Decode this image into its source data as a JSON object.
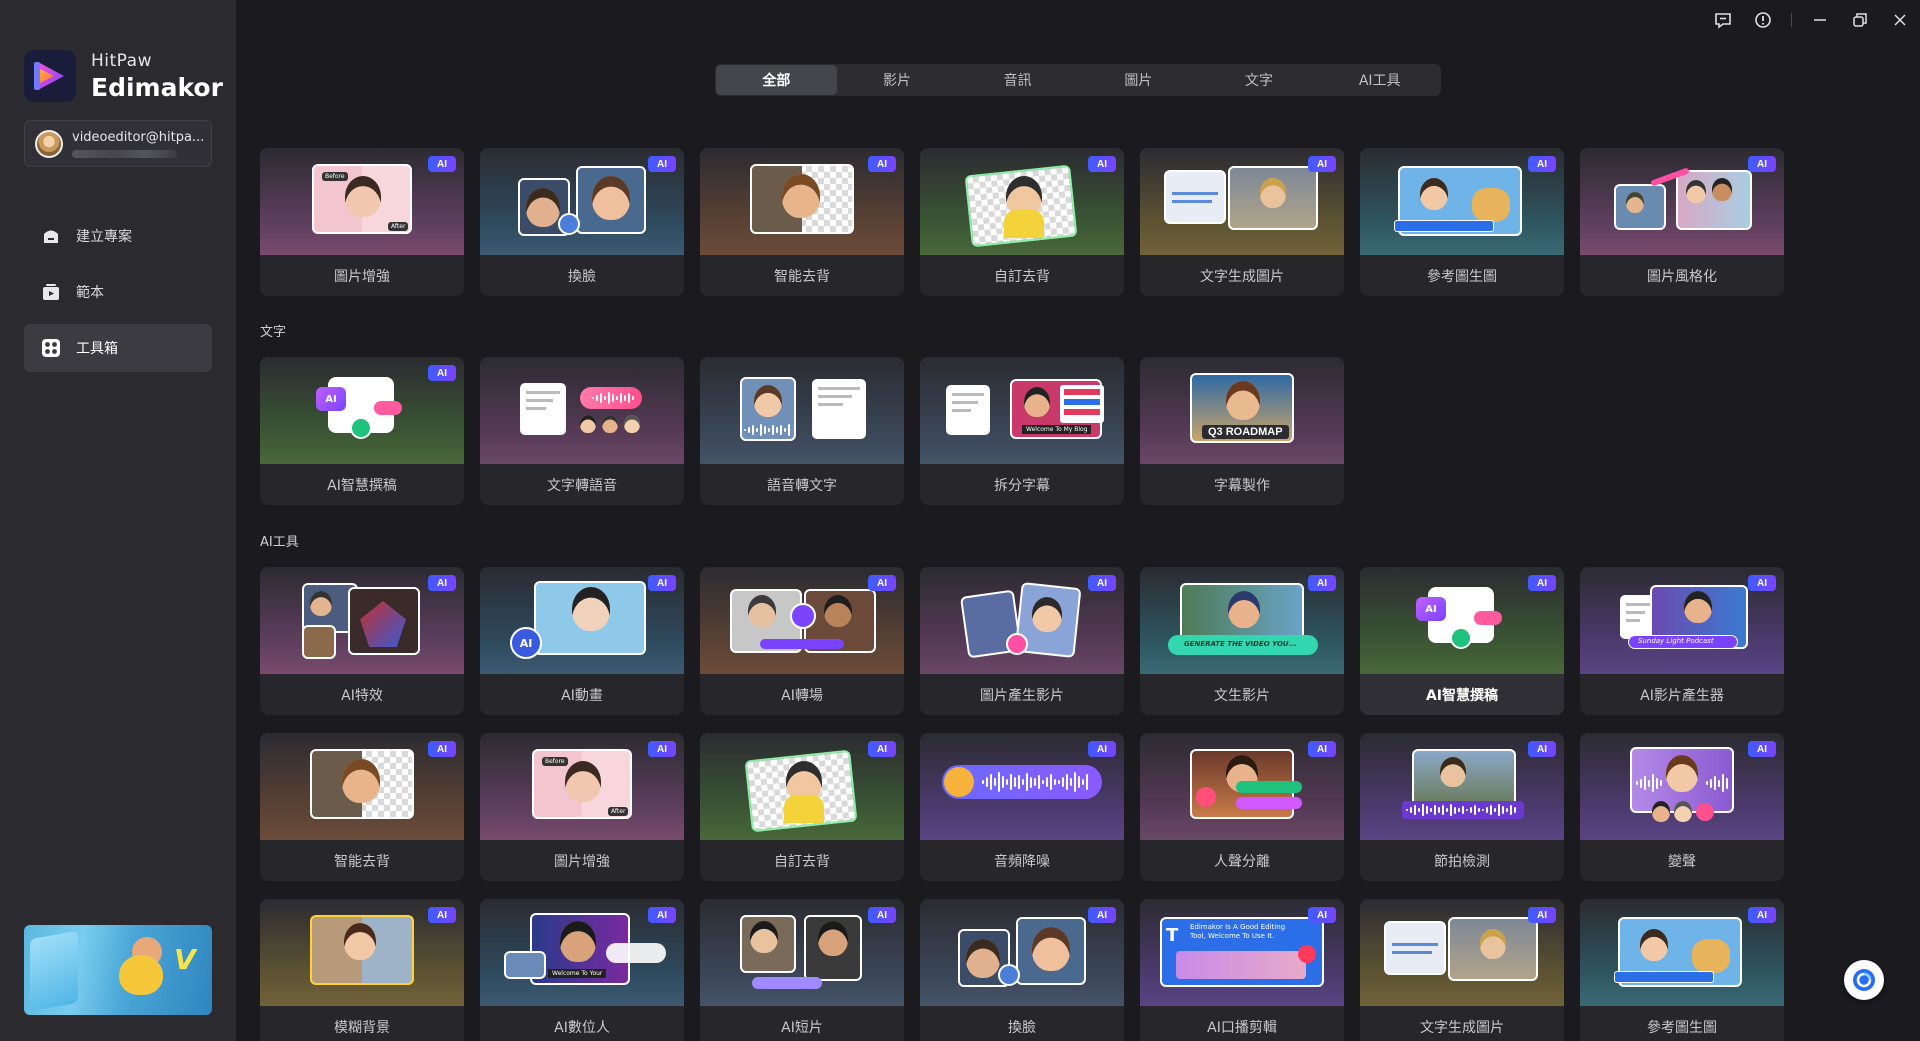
{
  "brand": {
    "line1": "HitPaw",
    "line2": "Edimakor"
  },
  "account": {
    "email": "videoeditor@hitpa..."
  },
  "nav": [
    {
      "label": "建立專案",
      "icon": "home-icon"
    },
    {
      "label": "範本",
      "icon": "template-icon"
    },
    {
      "label": "工具箱",
      "icon": "toolbox-icon",
      "active": true
    }
  ],
  "tabs": [
    "全部",
    "影片",
    "音訊",
    "圖片",
    "文字",
    "AI工具"
  ],
  "active_tab": "全部",
  "promo": {
    "text": "V"
  },
  "badge": "AI",
  "sections": {
    "text": "文字",
    "ai": "AI工具"
  },
  "rows": {
    "image": [
      "圖片增強",
      "換臉",
      "智能去背",
      "自訂去背",
      "文字生成圖片",
      "參考圖生圖",
      "圖片風格化"
    ],
    "text": [
      "AI智慧撰稿",
      "文字轉語音",
      "語音轉文字",
      "拆分字幕",
      "字幕製作"
    ],
    "ai1": [
      "AI特效",
      "AI動畫",
      "AI轉場",
      "圖片產生影片",
      "文生影片",
      "AI智慧撰稿",
      "AI影片產生器"
    ],
    "ai2": [
      "智能去背",
      "圖片增強",
      "自訂去背",
      "音頻降噪",
      "人聲分離",
      "節拍檢測",
      "變聲"
    ],
    "ai3": [
      "模糊背景",
      "AI數位人",
      "AI短片",
      "換臉",
      "AI口播剪輯",
      "文字生成圖片",
      "參考圖生圖"
    ]
  },
  "thumb_text": {
    "before": "Before",
    "after": "After",
    "roadmap": "Q3 ROADMAP",
    "generate": "GENERATE THE VIDEO YOU...",
    "podcast": "Sunday Light Podcast",
    "welcome_blog": "Welcome To My Blog",
    "welcome_your": "Welcome To Your",
    "edimakor": "Edimakor Is A Good Editing Tool, Welcome To Use It."
  },
  "colors": {
    "accent_blue": "#3d5cff",
    "accent_purple": "#7a43ff",
    "sidebar_bg": "#2a2a2f",
    "page_bg": "#1b1b1f"
  }
}
